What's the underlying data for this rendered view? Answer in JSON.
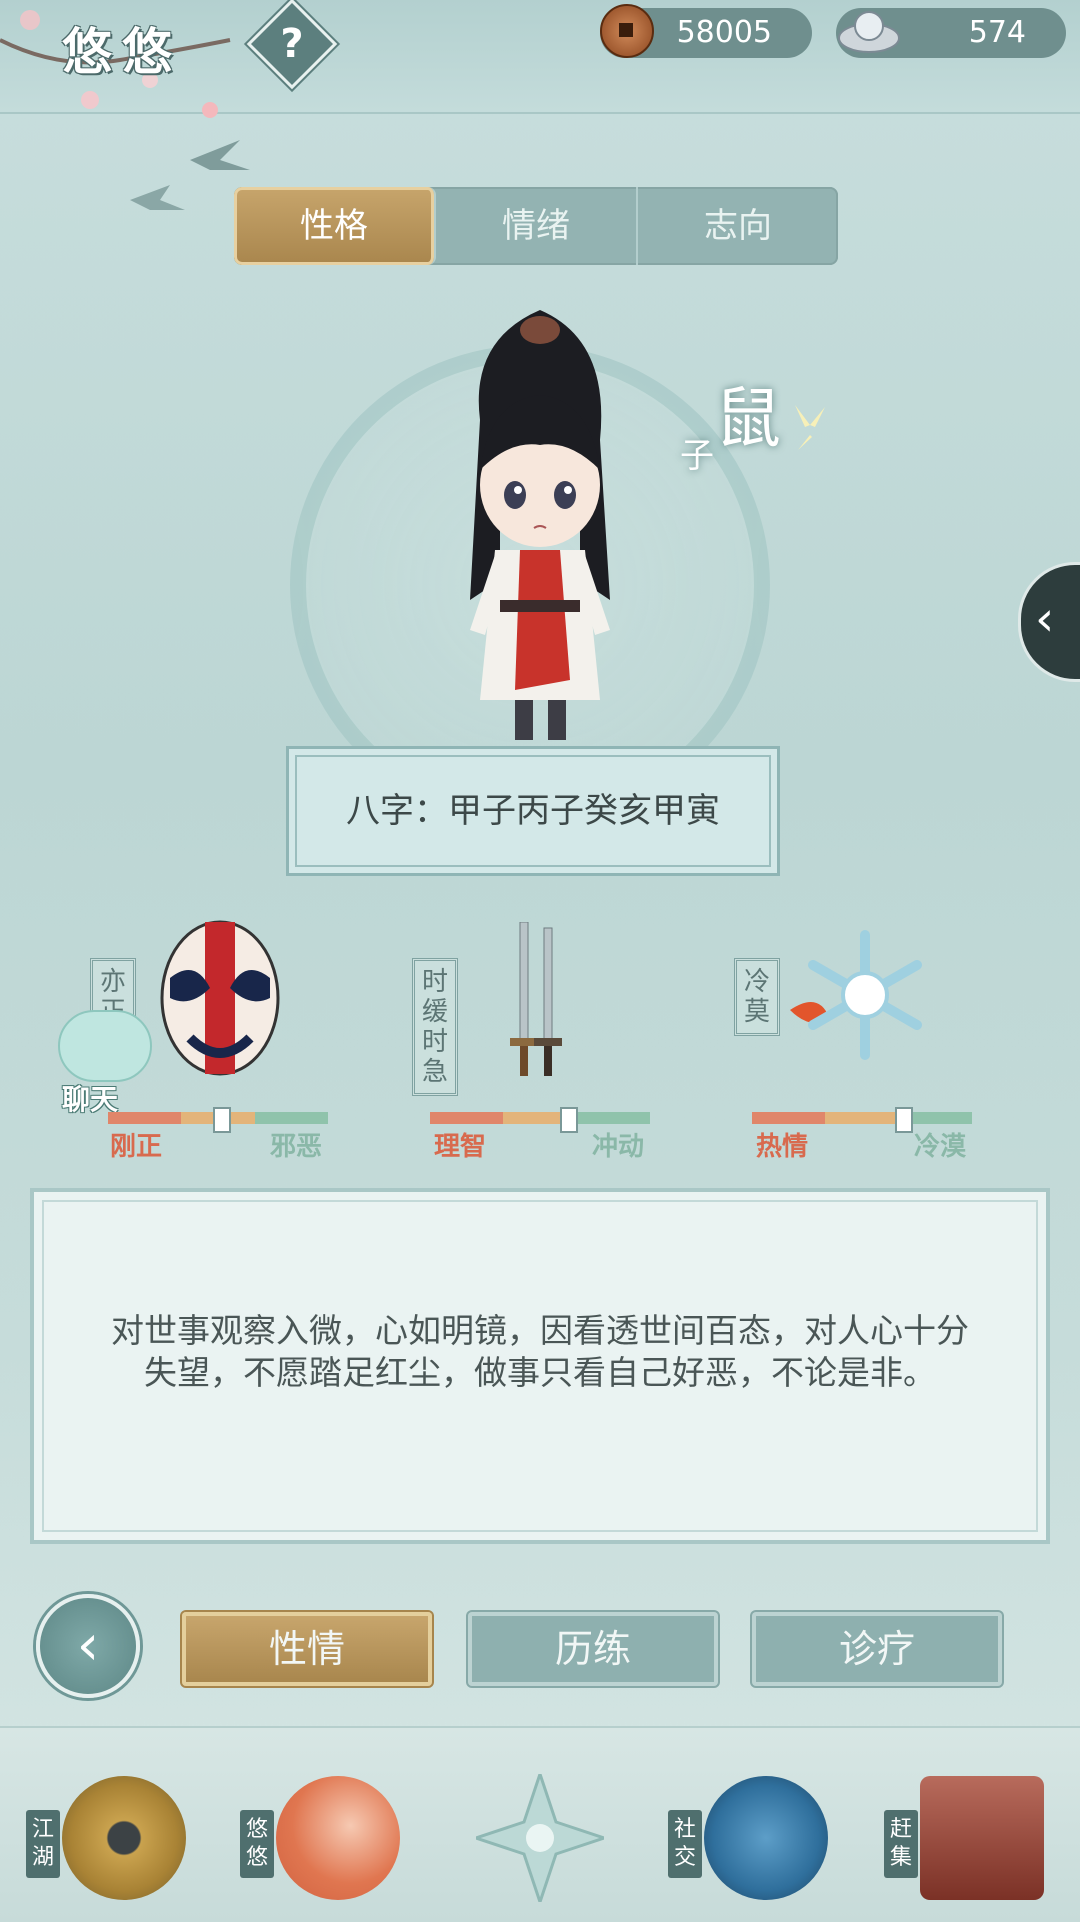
{
  "header": {
    "title": "悠悠",
    "help_label": "?",
    "coins": "58005",
    "silver": "574"
  },
  "tabs": [
    {
      "label": "性格",
      "active": true
    },
    {
      "label": "情绪",
      "active": false
    },
    {
      "label": "志向",
      "active": false
    }
  ],
  "character": {
    "zodiac_main": "鼠",
    "zodiac_sub": "子",
    "bazi": "八字：甲子丙子癸亥甲寅"
  },
  "traits": [
    {
      "tag": "亦正",
      "left": "刚正",
      "right": "邪恶",
      "level": 0.52,
      "icon": "opera-mask-icon"
    },
    {
      "tag": "时缓时急",
      "left": "理智",
      "right": "冲动",
      "level": 0.63,
      "icon": "twin-swords-icon"
    },
    {
      "tag": "冷莫",
      "left": "热情",
      "right": "冷漠",
      "level": 0.69,
      "icon": "snowflake-icon"
    }
  ],
  "chat": {
    "label": "聊天"
  },
  "description": "对世事观察入微，心如明镜，因看透世间百态，对人心十分失望，不愿踏足红尘，做事只看自己好恶，不论是非。",
  "sub_buttons": [
    {
      "label": "性情",
      "active": true
    },
    {
      "label": "历练",
      "active": false
    },
    {
      "label": "诊疗",
      "active": false
    }
  ],
  "nav": [
    {
      "label": "江湖",
      "icon": "straw-hat-icon"
    },
    {
      "label": "悠悠",
      "icon": "swallow-icon"
    },
    {
      "label": "社交",
      "icon": "wave-icon"
    },
    {
      "label": "赶集",
      "icon": "basket-icon"
    }
  ],
  "colors": {
    "accent_gold": "#b08f55",
    "teal": "#8eb0af",
    "bar_left": "#e0866a",
    "bar_mid": "#e3b47a",
    "bar_right": "#8fc3ab"
  }
}
